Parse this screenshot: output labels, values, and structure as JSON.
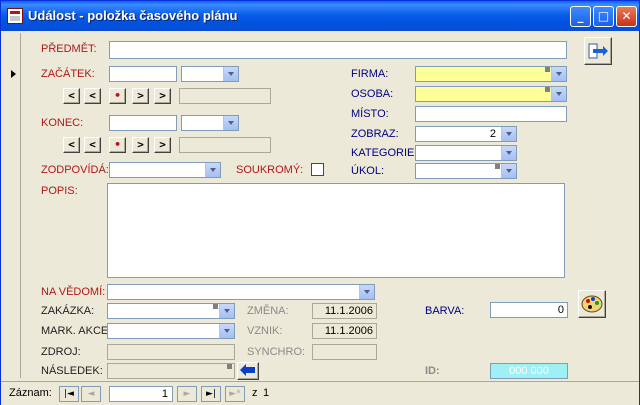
{
  "window": {
    "title": "Událost - položka časového plánu",
    "minimize_glyph": "_",
    "maximize_glyph": "□",
    "close_glyph": "✕"
  },
  "form": {
    "predmet": {
      "label": "PŘEDMĚT:",
      "value": ""
    },
    "zacatek": {
      "label": "ZAČÁTEK:",
      "date": "",
      "time": "",
      "extra": ""
    },
    "konec": {
      "label": "KONEC:",
      "date": "",
      "time": "",
      "extra": ""
    },
    "nav_buttons": [
      "<",
      "<",
      "•",
      ">",
      ">"
    ],
    "zodpovida": {
      "label": "ZODPOVÍDÁ:",
      "value": ""
    },
    "soukromy": {
      "label": "SOUKROMÝ:",
      "checked": false
    },
    "popis": {
      "label": "POPIS:",
      "value": ""
    },
    "firma": {
      "label": "FIRMA:",
      "value": ""
    },
    "osoba": {
      "label": "OSOBA:",
      "value": ""
    },
    "misto": {
      "label": "MÍSTO:",
      "value": ""
    },
    "zobraz": {
      "label": "ZOBRAZ:",
      "value": "2"
    },
    "kategorie": {
      "label": "KATEGORIE:",
      "value": ""
    },
    "ukol": {
      "label": "ÚKOL:",
      "value": ""
    },
    "na_vedomi": {
      "label": "NA VĚDOMÍ:",
      "value": ""
    },
    "zakazka": {
      "label": "ZAKÁZKA:",
      "value": ""
    },
    "mark_akce": {
      "label": "MARK. AKCE:",
      "value": ""
    },
    "zdroj": {
      "label": "ZDROJ:",
      "value": ""
    },
    "nasledek": {
      "label": "NÁSLEDEK:",
      "value": ""
    },
    "zmena": {
      "label": "ZMĚNA:",
      "value": "11.1.2006"
    },
    "vznik": {
      "label": "VZNIK:",
      "value": "11.1.2006"
    },
    "synchro": {
      "label": "SYNCHRO:",
      "value": ""
    },
    "barva": {
      "label": "BARVA:",
      "value": "0"
    },
    "id": {
      "label": "ID:",
      "value": "000 000"
    }
  },
  "statusbar": {
    "label": "Záznam:",
    "first": "|◄",
    "prev": "◄",
    "record": "1",
    "next": "►",
    "last": "►|",
    "new": "►*",
    "of_label": "z",
    "total": "1"
  },
  "colors": {
    "title_blue": "#0053e0",
    "label_red": "#b01818",
    "label_navy": "#000080",
    "required_yellow": "#ffff99",
    "id_teal": "#9ff0f4"
  }
}
